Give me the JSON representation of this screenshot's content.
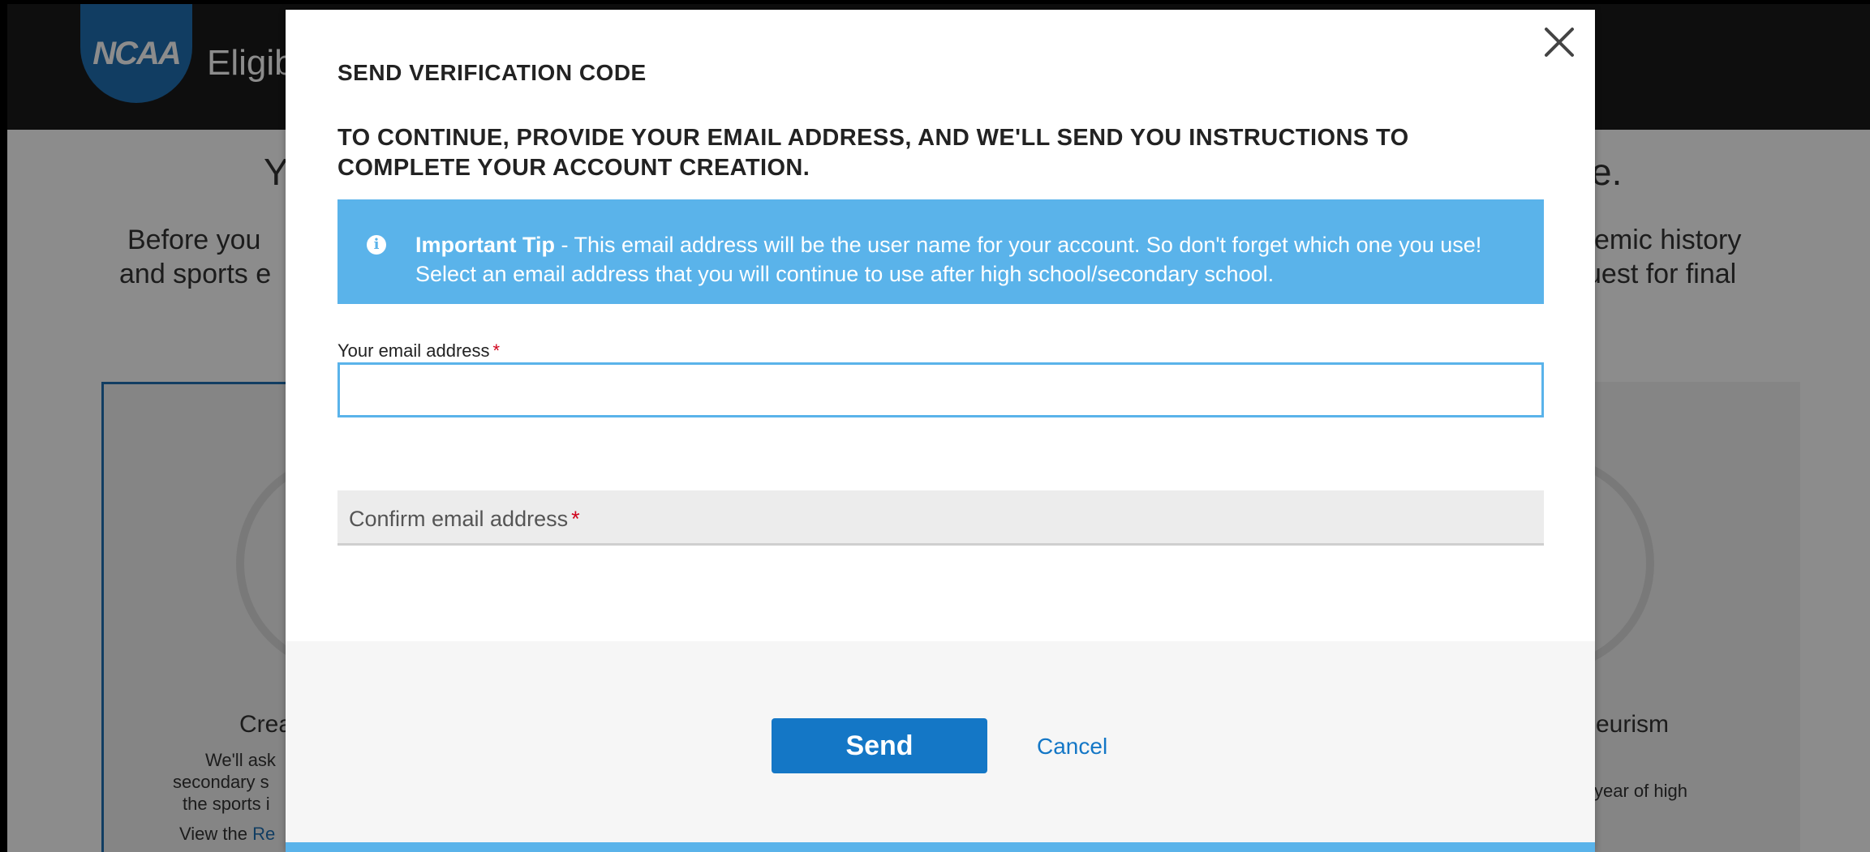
{
  "background": {
    "logo_text": "NCAA",
    "site_title": "Eligibi",
    "heading_left": "Y",
    "heading_right": "e.",
    "intro_left_line1": "Before you",
    "intro_left_line2": "and sports e",
    "intro_right_line1": "emic history",
    "intro_right_line2": "uest for final",
    "card_left_title": "Crea",
    "card_left_line1": "We'll ask",
    "card_left_line2": "secondary s",
    "card_left_line3": "the sports i",
    "card_left_line4": "View the",
    "card_left_link": "Re",
    "card_right_title": "eurism",
    "card_right_line1": "year of high"
  },
  "modal": {
    "title": "SEND VERIFICATION CODE",
    "subtitle": "TO CONTINUE, PROVIDE YOUR EMAIL ADDRESS, AND WE'LL SEND YOU INSTRUCTIONS TO COMPLETE YOUR ACCOUNT CREATION.",
    "tip": {
      "icon": "info-icon",
      "strong": "Important Tip",
      "text": " - This email address will be the user name for your account. So don't forget which one you use! Select an email address that you will continue to use after high school/secondary school."
    },
    "email_label": "Your email address",
    "email_value": "",
    "confirm_label": "Confirm email address",
    "confirm_value": "",
    "required_mark": "*",
    "send_label": "Send",
    "cancel_label": "Cancel"
  },
  "colors": {
    "accent": "#1477c6",
    "tip_bg": "#5ab3ea",
    "required": "#d0021b"
  }
}
